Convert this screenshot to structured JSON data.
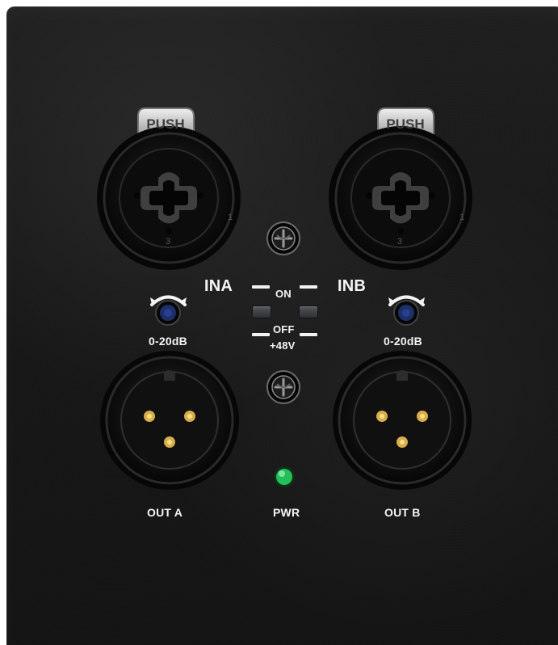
{
  "labels": {
    "input_a": "INA",
    "input_b": "INB",
    "pad_a": "0-20dB",
    "pad_b": "0-20dB",
    "switch_on": "ON",
    "switch_off": "OFF",
    "phantom_power": "+48V",
    "output_a": "OUT A",
    "output_b": "OUT B",
    "power": "PWR"
  },
  "connector_labels": {
    "push_a": "PUSH",
    "push_b": "PUSH",
    "pin1": "1",
    "pin3": "3"
  },
  "colors": {
    "panel": "#181818",
    "text": "#f5f5f5",
    "led": "#21c05a",
    "pad_knob": "#1e2f68",
    "connector_ring": "#0f0f10",
    "connector_pin": "#d8ae4a",
    "tab_metal": "#c9c9c9"
  },
  "icons": {
    "input_jack": "combo-xlr-jack-icon",
    "output_jack": "xlr-output-jack-icon",
    "screw": "screw-icon",
    "pad_control": "rotary-knob-icon",
    "power_led": "green-led-icon",
    "switch": "toggle-switch-icon"
  }
}
